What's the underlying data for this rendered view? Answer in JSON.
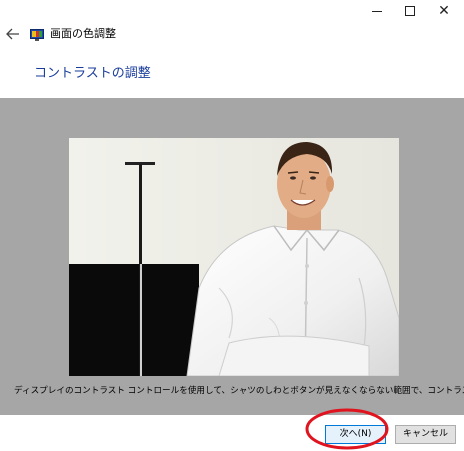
{
  "window": {
    "title": "画面の色調整",
    "controls": {
      "minimize_icon": "minimize-icon",
      "maximize_icon": "maximize-icon",
      "close_icon": "close-icon",
      "close_glyph": "✕"
    }
  },
  "header": {
    "back_icon": "back-arrow-icon",
    "app_icon": "display-settings-icon",
    "page_heading": "コントラストの調整"
  },
  "main": {
    "image_desc": "contrast-calibration-photo",
    "instruction": "ディスプレイのコントラスト コントロールを使用して、シャツのしわとボタンが見えなくならない範囲で、コントラストを上げます。"
  },
  "footer": {
    "next_label": "次へ(N)",
    "cancel_label": "キャンセル"
  },
  "colors": {
    "heading": "#1a3d9c",
    "content_bg": "#a6a6a6",
    "annotation": "#e0141e",
    "primary_border": "#0078d7"
  }
}
